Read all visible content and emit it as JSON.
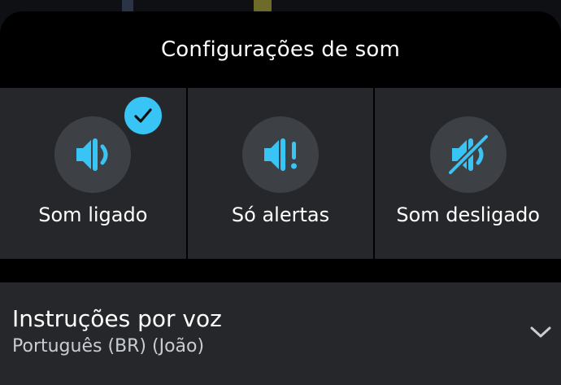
{
  "sheet": {
    "title": "Configurações de som"
  },
  "sound_options": [
    {
      "label": "Som ligado",
      "icon": "speaker-on-icon",
      "selected": true
    },
    {
      "label": "Só alertas",
      "icon": "speaker-alert-icon",
      "selected": false
    },
    {
      "label": "Som desligado",
      "icon": "speaker-muted-icon",
      "selected": false
    }
  ],
  "voice": {
    "title": "Instruções por voz",
    "value": "Português (BR) (João)",
    "icon": "chevron-down-icon"
  },
  "colors": {
    "accent": "#38c4f4",
    "sheet_background": "#000000",
    "tile_background": "#25272b",
    "icon_circle": "#3d4044"
  }
}
